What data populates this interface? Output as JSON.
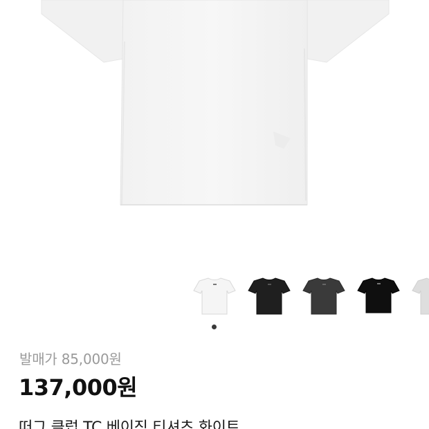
{
  "product": {
    "original_price_label": "발매가 85,000원",
    "sale_price": "137,000원",
    "title": "떠그 클럽 TC 베이직 티셔츠 화이트"
  },
  "gallery": {
    "main_image": "white-tshirt-image",
    "thumbnails": [
      {
        "name": "white-tshirt-thumbnail",
        "color": "#f5f5f5"
      },
      {
        "name": "black-tshirt-thumbnail",
        "color": "#1f1f1f"
      },
      {
        "name": "charcoal-tshirt-thumbnail",
        "color": "#3a3a3a"
      },
      {
        "name": "black-logo-tshirt-thumbnail",
        "color": "#0f0f0f"
      },
      {
        "name": "gray-tshirt-thumbnail",
        "color": "#dedede"
      }
    ],
    "active_index": 0
  },
  "colors": {
    "price_gray": "#9a9a9a",
    "text_dark": "#111111",
    "dot": "#3a3a3a"
  }
}
